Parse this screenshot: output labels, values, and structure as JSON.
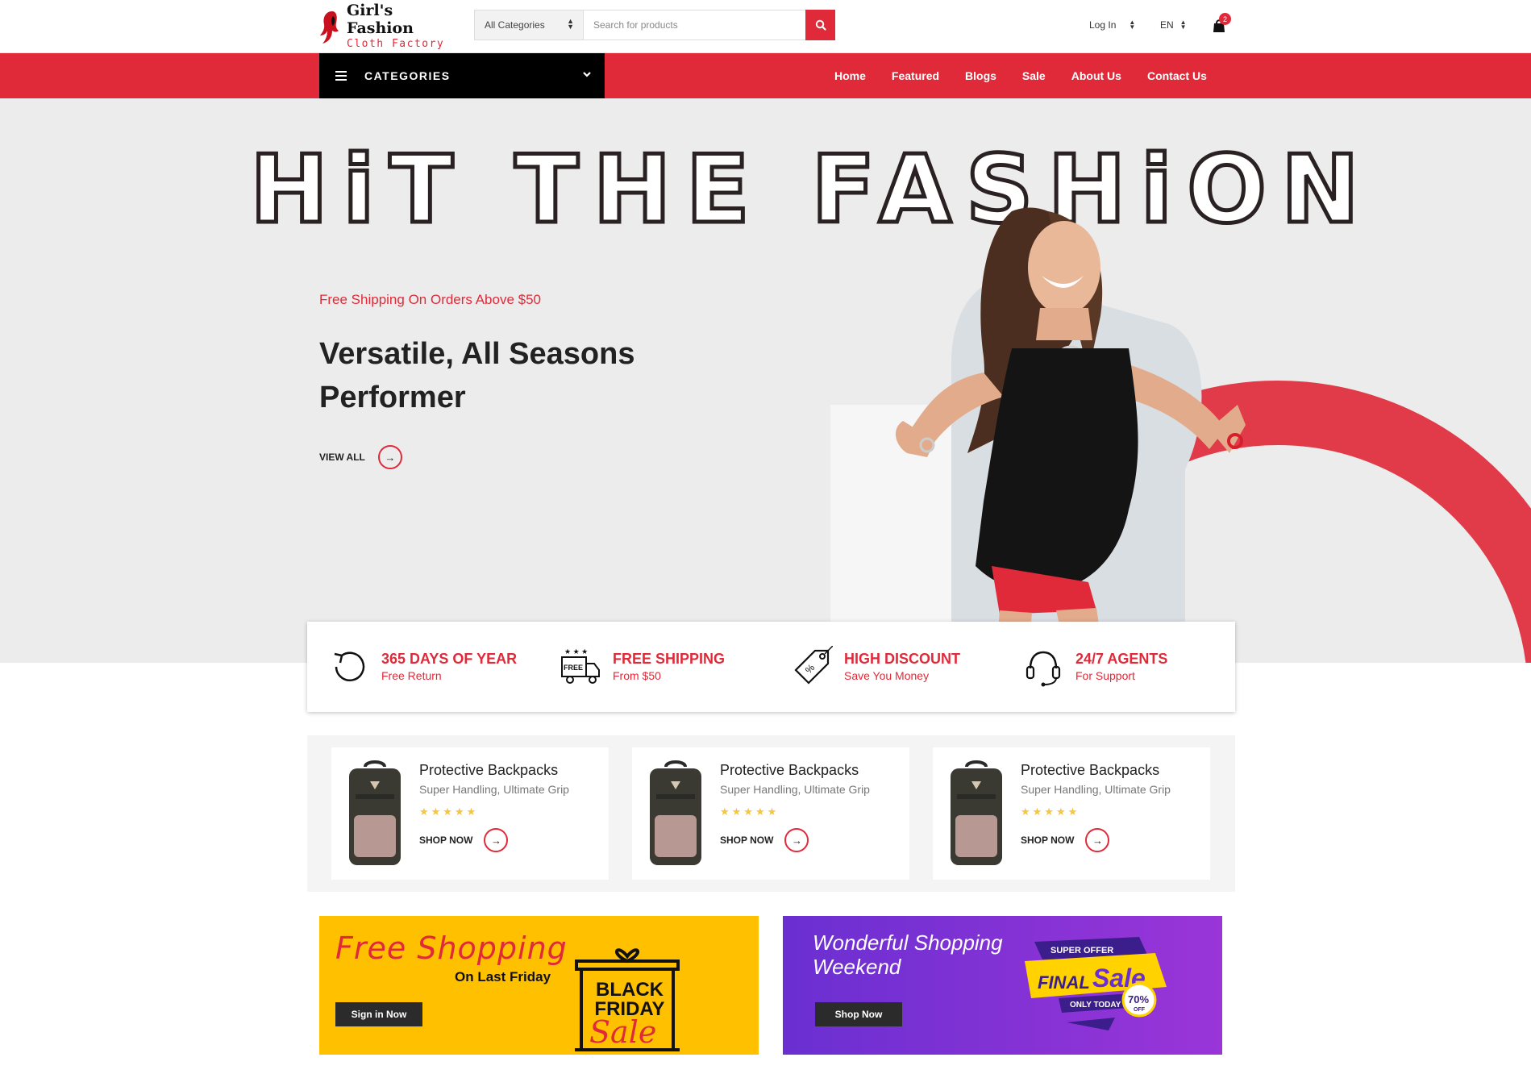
{
  "brand": {
    "name": "Girl's Fashion",
    "tagline": "Cloth Factory"
  },
  "search": {
    "category": "All Categories",
    "placeholder": "Search for products"
  },
  "header": {
    "login": "Log In",
    "language": "EN",
    "cart_count": "2"
  },
  "nav": {
    "categories_label": "CATEGORIES",
    "links": [
      "Home",
      "Featured",
      "Blogs",
      "Sale",
      "About Us",
      "Contact Us"
    ]
  },
  "hero": {
    "headline": "HiT THE FASHiON",
    "kicker": "Free Shipping On Orders Above $50",
    "title": "Versatile, All Seasons Performer",
    "cta": "VIEW ALL"
  },
  "features": [
    {
      "icon": "return-arrow-icon",
      "title": "365 DAYS OF YEAR",
      "subtitle": "Free Return"
    },
    {
      "icon": "free-delivery-truck-icon",
      "title": "FREE SHIPPING",
      "subtitle": "From $50"
    },
    {
      "icon": "discount-tag-icon",
      "title": "HIGH DISCOUNT",
      "subtitle": "Save You Money"
    },
    {
      "icon": "headset-icon",
      "title": "24/7 AGENTS",
      "subtitle": "For Support"
    }
  ],
  "products": [
    {
      "title": "Protective Backpacks",
      "subtitle": "Super Handling, Ultimate Grip",
      "rating": 5,
      "cta": "SHOP NOW"
    },
    {
      "title": "Protective Backpacks",
      "subtitle": "Super Handling, Ultimate Grip",
      "rating": 5,
      "cta": "SHOP NOW"
    },
    {
      "title": "Protective Backpacks",
      "subtitle": "Super Handling, Ultimate Grip",
      "rating": 5,
      "cta": "SHOP NOW"
    }
  ],
  "banners": {
    "left": {
      "title": "Free Shopping",
      "subtitle": "On Last Friday",
      "cta": "Sign in Now",
      "badge_line1": "BLACK",
      "badge_line2": "FRIDAY",
      "badge_line3": "Sale"
    },
    "right": {
      "title": "Wonderful Shopping Weekend",
      "cta": "Shop Now",
      "badge_top": "SUPER OFFER",
      "badge_final": "FINAL",
      "badge_sale": "Sale",
      "badge_today": "ONLY TODAY",
      "badge_pct": "70%",
      "badge_off": "OFF"
    }
  },
  "colors": {
    "accent": "#e02a39",
    "dark": "#000000",
    "banner_yellow": "#ffc000",
    "banner_purple": "#8a33d6"
  }
}
